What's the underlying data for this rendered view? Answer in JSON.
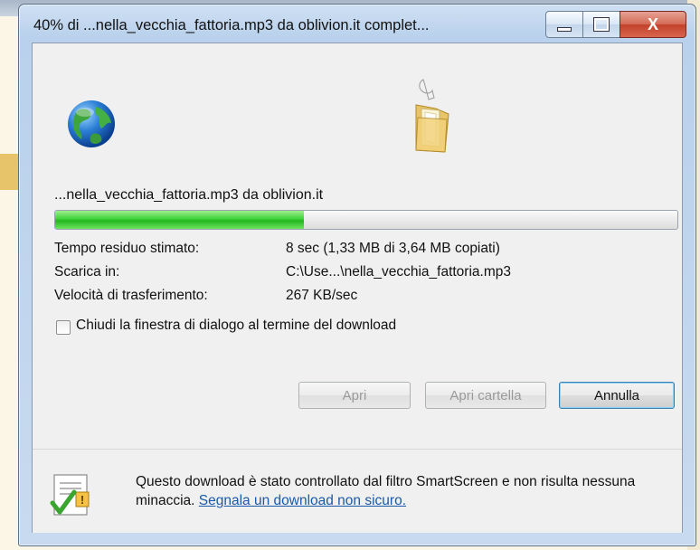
{
  "window": {
    "title": "40% di ...nella_vecchia_fattoria.mp3 da oblivion.it complet...",
    "controls": {
      "minimize": "minimize",
      "maximize": "maximize",
      "close": "X"
    }
  },
  "download": {
    "filename": "...nella_vecchia_fattoria.mp3 da oblivion.it",
    "progress_percent": 40,
    "rows": [
      {
        "label": "Tempo residuo stimato:",
        "value": "8 sec (1,33 MB di 3,64 MB copiati)"
      },
      {
        "label": "Scarica in:",
        "value": "C:\\Use...\\nella_vecchia_fattoria.mp3"
      },
      {
        "label": "Velocità di trasferimento:",
        "value": "267 KB/sec"
      }
    ],
    "close_on_complete": {
      "label": "Chiudi la finestra di dialogo al termine del download",
      "checked": false
    }
  },
  "buttons": {
    "open": "Apri",
    "open_folder": "Apri cartella",
    "cancel": "Annulla"
  },
  "footer": {
    "message": "Questo download è stato controllato dal filtro SmartScreen e non risulta nessuna minaccia. ",
    "link": "Segnala un download non sicuro."
  },
  "colors": {
    "progress_green": "#22b61f",
    "link_blue": "#1b5aa8",
    "close_red": "#c2412a"
  },
  "icons": [
    "globe-icon",
    "folder-icon",
    "shield-check-icon"
  ]
}
